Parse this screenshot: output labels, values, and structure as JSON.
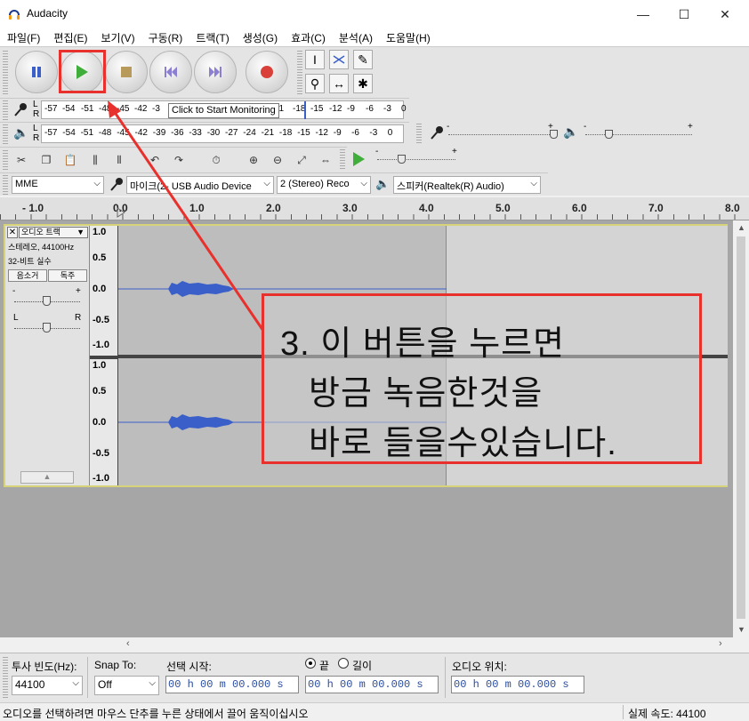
{
  "window": {
    "title": "Audacity",
    "min_glyph": "—",
    "max_glyph": "☐",
    "close_glyph": "✕"
  },
  "menu": [
    "파일(F)",
    "편집(E)",
    "보기(V)",
    "구동(R)",
    "트랙(T)",
    "생성(G)",
    "효과(C)",
    "분석(A)",
    "도움말(H)"
  ],
  "meters": {
    "record_scale": [
      "-57",
      "-54",
      "-51",
      "-48",
      "-45",
      "-42",
      "-3",
      "21",
      "-18",
      "-15",
      "-12",
      "-9",
      "-6",
      "-3",
      "0"
    ],
    "play_scale": [
      "-57",
      "-54",
      "-51",
      "-48",
      "-45",
      "-42",
      "-39",
      "-36",
      "-33",
      "-30",
      "-27",
      "-24",
      "-21",
      "-18",
      "-15",
      "-12",
      "-9",
      "-6",
      "-3",
      "0"
    ],
    "channel_l": "L",
    "channel_r": "R",
    "tooltip": "Click to Start Monitoring",
    "slider_minus": "-",
    "slider_plus": "+"
  },
  "devices": {
    "host": "MME",
    "input": "마이크(2- USB Audio Device",
    "channels": "2 (Stereo) Reco",
    "output": "스피커(Realtek(R) Audio)"
  },
  "ruler": [
    "- 1.0",
    "0.0",
    "1.0",
    "2.0",
    "3.0",
    "4.0",
    "5.0",
    "6.0",
    "7.0",
    "8.0"
  ],
  "track": {
    "name": "오디오 트랙",
    "info1": "스테레오, 44100Hz",
    "info2": "32-비트 실수",
    "mute": "음소거",
    "solo": "독주",
    "gain_minus": "-",
    "gain_plus": "+",
    "pan_l": "L",
    "pan_r": "R",
    "scale": [
      "1.0",
      "0.5",
      "0.0",
      "-0.5",
      "-1.0"
    ]
  },
  "selection_bar": {
    "rate_label": "투사 빈도(Hz):",
    "rate_value": "44100",
    "snap_label": "Snap To:",
    "snap_value": "Off",
    "sel_start_label": "선택 시작:",
    "end_label": "끝",
    "length_label": "길이",
    "audio_pos_label": "오디오 위치:",
    "time_value": "00 h 00 m 00.000 s"
  },
  "status": {
    "left": "오디오를 선택하려면 마우스 단추를 누른 상태에서 끌어 움직이십시오",
    "right": "실제 속도: 44100"
  },
  "annotation": {
    "line1": "3. 이 버튼을 누르면",
    "line2": "방금 녹음한것을",
    "line3": "바로 들을수있습니다.",
    "color": "#e8302c"
  }
}
